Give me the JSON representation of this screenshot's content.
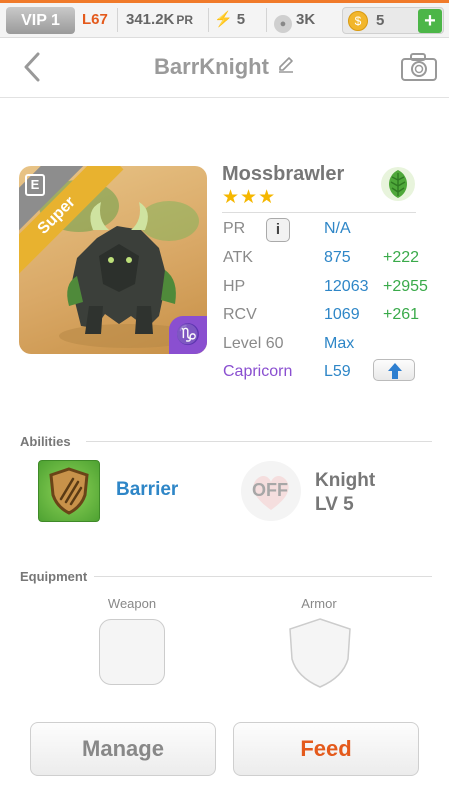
{
  "topbar": {
    "vip": "VIP 1",
    "level": "L67",
    "pr_value": "341.2K",
    "pr_unit": "PR",
    "energy": "5",
    "paws": "3K",
    "coins": "5",
    "plus": "+",
    "colors": {
      "accent": "#f07a2a",
      "level": "#e45a1c",
      "plus": "#4cb648"
    }
  },
  "header": {
    "title": "BarrKnight",
    "icons": [
      "chevron-left-icon",
      "pencil-icon",
      "camera-icon"
    ]
  },
  "monster": {
    "name": "Mossbrawler",
    "stars": "★★★",
    "rarity_ribbon": "Super",
    "evo_badge": "E",
    "zodiac_badge": "♑",
    "element_icon": "leaf-icon",
    "stats": [
      {
        "label": "PR",
        "value": "N/A",
        "bonus": ""
      },
      {
        "label": "ATK",
        "value": "875",
        "bonus": "+222"
      },
      {
        "label": "HP",
        "value": "12063",
        "bonus": "+2955"
      },
      {
        "label": "RCV",
        "value": "1069",
        "bonus": "+261"
      },
      {
        "label": "Level 60",
        "value": "Max",
        "bonus": ""
      },
      {
        "label": "Capricorn",
        "value": "L59",
        "bonus": ""
      }
    ],
    "info_glyph": "i"
  },
  "abilities": {
    "section_label": "Abilities",
    "ability_name": "Barrier",
    "off_label": "OFF",
    "knight_line1": "Knight",
    "knight_line2": "LV 5"
  },
  "equipment": {
    "section_label": "Equipment",
    "weapon_label": "Weapon",
    "armor_label": "Armor"
  },
  "actions": {
    "manage": "Manage",
    "feed": "Feed"
  }
}
